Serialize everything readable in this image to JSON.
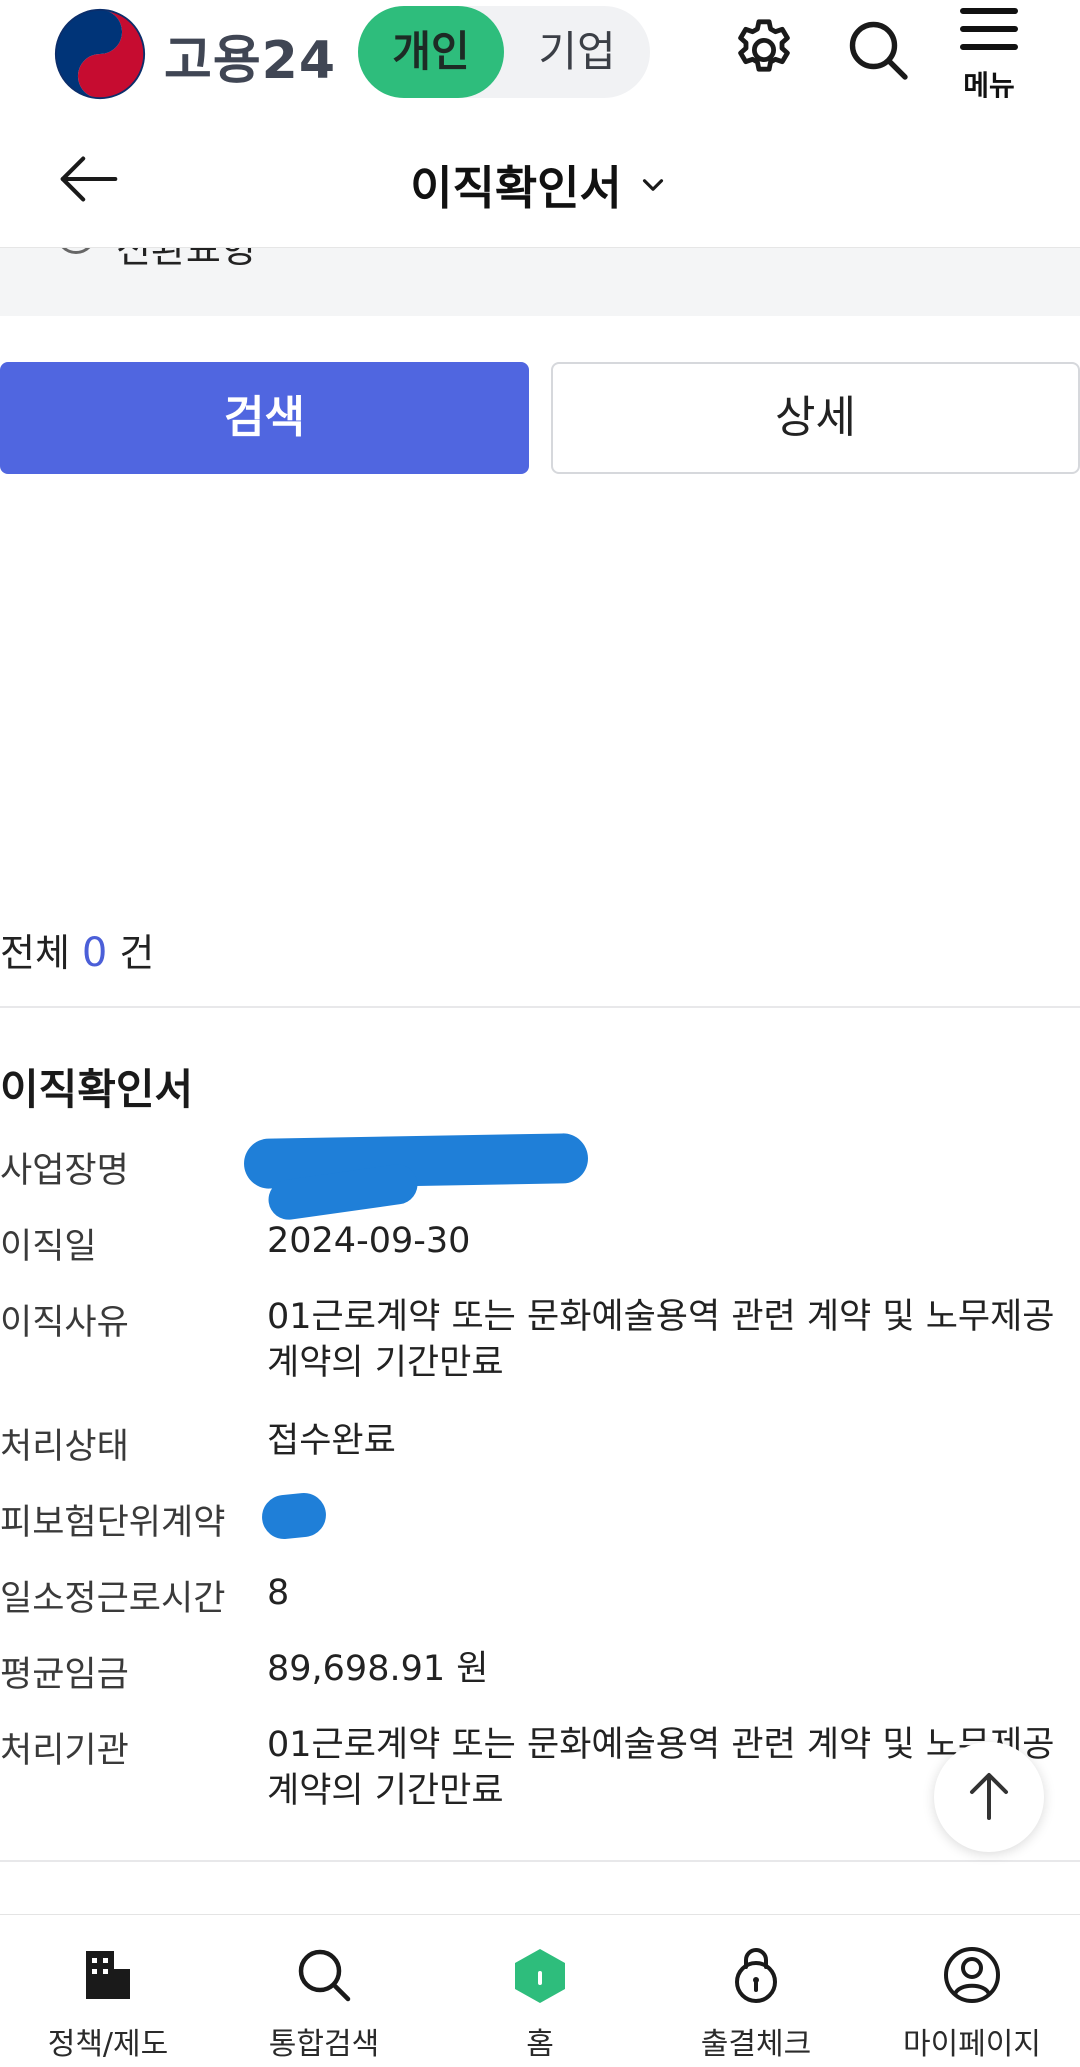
{
  "header": {
    "brand": "고용24",
    "toggle_personal": "개인",
    "toggle_company": "기업",
    "menu_label": "메뉴"
  },
  "subheader": {
    "title": "이직확인서"
  },
  "filter": {
    "partial_option": "전환표형"
  },
  "actions": {
    "search": "검색",
    "detail": "상세"
  },
  "results": {
    "total_prefix": "전체",
    "total_count": "0",
    "total_suffix": "건"
  },
  "record": {
    "title": "이직확인서",
    "fields": [
      {
        "label": "사업장명",
        "value": ""
      },
      {
        "label": "이직일",
        "value": "2024-09-30"
      },
      {
        "label": "이직사유",
        "value": "01근로계약 또는 문화예술용역 관련 계약 및 노무제공계약의 기간만료"
      },
      {
        "label": "처리상태",
        "value": "접수완료"
      },
      {
        "label": "피보험단위계약",
        "value": ""
      },
      {
        "label": "일소정근로시간",
        "value": "8"
      },
      {
        "label": "평균임금",
        "value": "89,698.91 원"
      },
      {
        "label": "처리기관",
        "value": "01근로계약 또는 문화예술용역 관련 계약 및 노무제공계약의 기간만료"
      }
    ]
  },
  "bottom_nav": {
    "items": [
      {
        "label": "정책/제도",
        "icon": "building-icon"
      },
      {
        "label": "통합검색",
        "icon": "search-icon"
      },
      {
        "label": "홈",
        "icon": "home-icon"
      },
      {
        "label": "출결체크",
        "icon": "lock-icon"
      },
      {
        "label": "마이페이지",
        "icon": "user-icon"
      }
    ]
  },
  "colors": {
    "accent_green": "#2ebd7c",
    "primary_blue": "#5066e0",
    "count_blue": "#4b5fd8"
  }
}
